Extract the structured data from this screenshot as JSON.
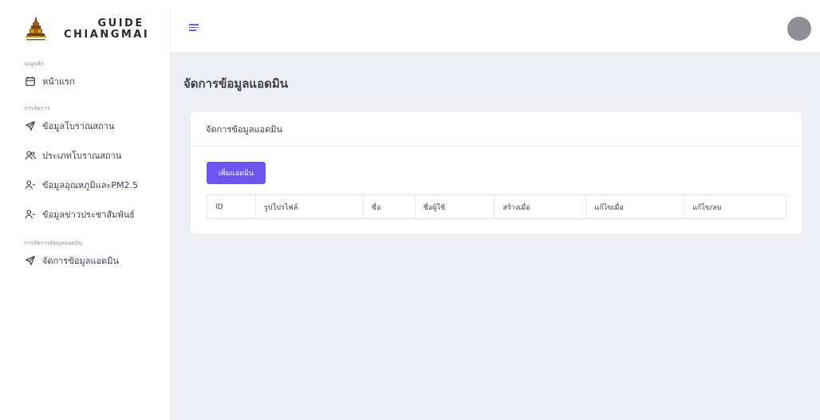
{
  "brand": {
    "line1": "GUIDE",
    "line2": "CHIANGMAI"
  },
  "sidebar": {
    "sections": [
      {
        "label": "เมนูหลัก",
        "items": [
          {
            "label": "หน้าแรก",
            "icon": "calendar-icon"
          }
        ]
      },
      {
        "label": "การจัดการ",
        "items": [
          {
            "label": "ข้อมูลโบราณสถาน",
            "icon": "send-icon"
          },
          {
            "label": "ประเภทโบราณสถาน",
            "icon": "users-icon"
          },
          {
            "label": "ข้อมูลอุณหภูมิและPM2.5",
            "icon": "user-minus-icon"
          },
          {
            "label": "ข้อมูลข่าวประชาสัมพันธ์",
            "icon": "user-minus-icon"
          }
        ]
      },
      {
        "label": "การจัดการข้อมูลแอดมิน",
        "items": [
          {
            "label": "จัดการข้อมูลแอดมิน",
            "icon": "send-icon"
          }
        ]
      }
    ]
  },
  "main": {
    "page_title": "จัดการข้อมูลแอดมิน",
    "card_title": "จัดการข้อมูลแอดมิน",
    "add_button": "เพิ่มแอดมิน",
    "table_headers": [
      "ID",
      "รูปโปรไฟล์",
      "ชื่อ",
      "ชื่อผู้ใช้",
      "สร้างเมื่อ",
      "แก้ไขเมื่อ",
      "แก้ไข/ลบ"
    ]
  },
  "colors": {
    "accent": "#6b56f0",
    "background": "#eeeff4",
    "avatar": "#8e8e98"
  }
}
